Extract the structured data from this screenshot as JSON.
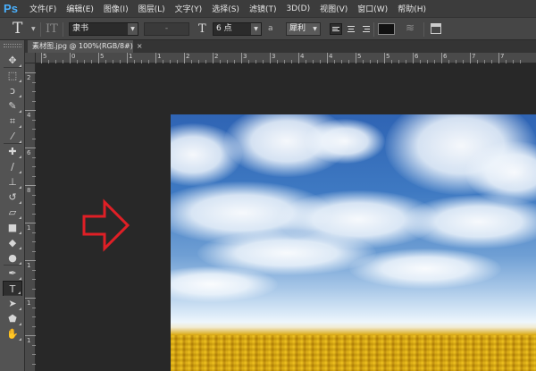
{
  "app": {
    "logo": "Ps"
  },
  "menu": [
    {
      "label": "文件(F)"
    },
    {
      "label": "编辑(E)"
    },
    {
      "label": "图像(I)"
    },
    {
      "label": "图层(L)"
    },
    {
      "label": "文字(Y)"
    },
    {
      "label": "选择(S)"
    },
    {
      "label": "滤镜(T)"
    },
    {
      "label": "3D(D)"
    },
    {
      "label": "视图(V)"
    },
    {
      "label": "窗口(W)"
    },
    {
      "label": "帮助(H)"
    }
  ],
  "options": {
    "tool_glyph": "T",
    "orient_glyph": "IT",
    "font_family": "隶书",
    "font_style": "-",
    "size_glyph": "T",
    "font_size": "6 点",
    "antialias_label": "a",
    "antialias_value": "犀利",
    "text_color": "#111111"
  },
  "document": {
    "tab_title": "素材图.jpg @ 100%(RGB/8#)",
    "close_glyph": "×"
  },
  "ruler": {
    "top_labels": [
      "5",
      "0",
      "5",
      "1",
      "1",
      "2",
      "2",
      "3",
      "3",
      "4",
      "4",
      "5",
      "5",
      "6",
      "6",
      "7",
      "7"
    ],
    "left_labels": [
      "2",
      "4",
      "6",
      "8",
      "1",
      "1",
      "1",
      "1"
    ]
  },
  "tools": [
    {
      "name": "move",
      "glyph": "✥"
    },
    {
      "name": "marquee",
      "glyph": "⬚"
    },
    {
      "name": "lasso",
      "glyph": "ↄ"
    },
    {
      "name": "quick-select",
      "glyph": "✎"
    },
    {
      "name": "crop",
      "glyph": "⌗"
    },
    {
      "name": "eyedropper",
      "glyph": "⁄"
    },
    {
      "name": "healing",
      "glyph": "✚"
    },
    {
      "name": "brush",
      "glyph": "∕"
    },
    {
      "name": "stamp",
      "glyph": "⊥"
    },
    {
      "name": "history-brush",
      "glyph": "↺"
    },
    {
      "name": "eraser",
      "glyph": "▱"
    },
    {
      "name": "gradient",
      "glyph": "■"
    },
    {
      "name": "blur",
      "glyph": "◆"
    },
    {
      "name": "dodge",
      "glyph": "●"
    },
    {
      "name": "pen",
      "glyph": "✒"
    },
    {
      "name": "type",
      "glyph": "T"
    },
    {
      "name": "path-select",
      "glyph": "➤"
    },
    {
      "name": "shape",
      "glyph": "⬟"
    },
    {
      "name": "hand",
      "glyph": "✋"
    }
  ],
  "colors": {
    "annotation_arrow": "#e01f26",
    "sky_top": "#2f64b4",
    "field": "#d9a80f"
  }
}
